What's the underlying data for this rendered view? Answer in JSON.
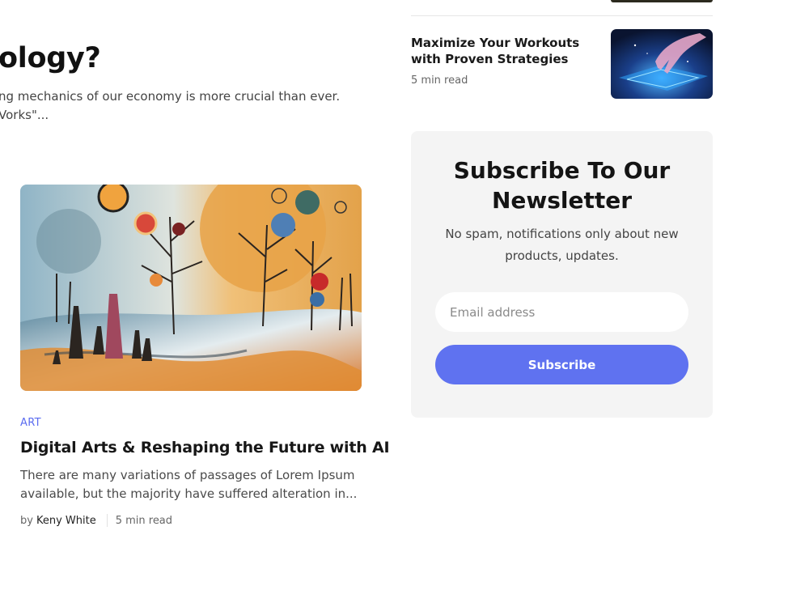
{
  "featured_post": {
    "title_fragment": "ology?",
    "excerpt_fragment": "ng mechanics of our economy is more crucial than ever.\nVorks\"..."
  },
  "article_card": {
    "category": "ART",
    "title": "Digital Arts & Reshaping the Future with AI",
    "excerpt": "There are many variations of passages of Lorem Ipsum available, but the majority have suffered alteration in...",
    "by_label": "by",
    "author": "Keny White",
    "read_time": "5 min read"
  },
  "sidebar": {
    "mini_post": {
      "title": "Maximize Your Workouts with Proven Strategies",
      "read_time": "5 min read"
    },
    "newsletter": {
      "title": "Subscribe To Our Newsletter",
      "description": "No spam, notifications only about new products, updates.",
      "email_placeholder": "Email address",
      "subscribe_label": "Subscribe"
    }
  },
  "colors": {
    "accent": "#5f72f0",
    "category": "#5b6cf0",
    "panel_bg": "#f4f4f4"
  }
}
